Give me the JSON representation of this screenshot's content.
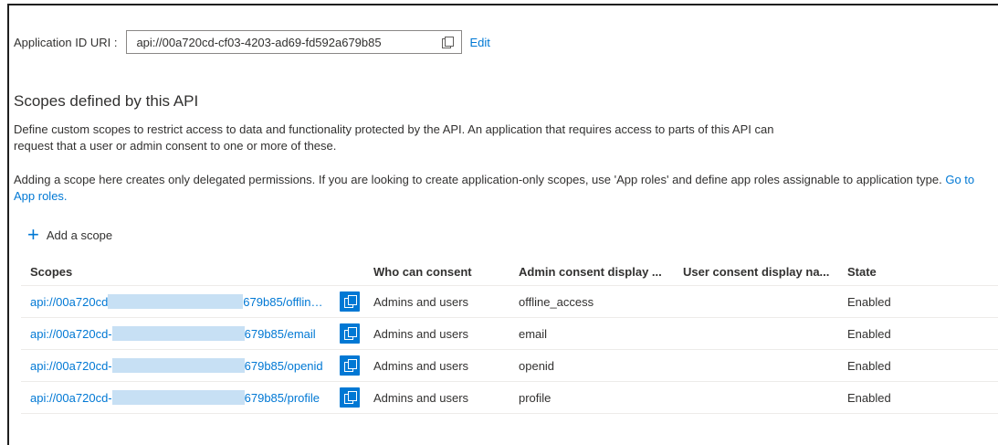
{
  "app_id": {
    "label": "Application ID URI :",
    "value": "api://00a720cd-cf03-4203-ad69-fd592a679b85",
    "edit_label": "Edit"
  },
  "section": {
    "title": "Scopes defined by this API",
    "desc1": "Define custom scopes to restrict access to data and functionality protected by the API. An application that requires access to parts of this API can request that a user or admin consent to one or more of these.",
    "desc2_text": "Adding a scope here creates only delegated permissions. If you are looking to create application-only scopes, use 'App roles' and define app roles assignable to application type. ",
    "desc2_link": "Go to App roles."
  },
  "add_scope_label": "Add a scope",
  "table": {
    "headers": [
      "Scopes",
      "Who can consent",
      "Admin consent display ...",
      "User consent display na...",
      "State"
    ],
    "rows": [
      {
        "scope_prefix": "api://00a720cd",
        "scope_suffix": "679b85/offlin…",
        "who": "Admins and users",
        "admin": "offline_access",
        "user": "",
        "state": "Enabled"
      },
      {
        "scope_prefix": "api://00a720cd-",
        "scope_suffix": "679b85/email",
        "who": "Admins and users",
        "admin": "email",
        "user": "",
        "state": "Enabled"
      },
      {
        "scope_prefix": "api://00a720cd-",
        "scope_suffix": "679b85/openid",
        "who": "Admins and users",
        "admin": "openid",
        "user": "",
        "state": "Enabled"
      },
      {
        "scope_prefix": "api://00a720cd-",
        "scope_suffix": "679b85/profile",
        "who": "Admins and users",
        "admin": "profile",
        "user": "",
        "state": "Enabled"
      }
    ]
  },
  "colors": {
    "accent": "#0078d4",
    "redaction": "#c7e0f4"
  }
}
